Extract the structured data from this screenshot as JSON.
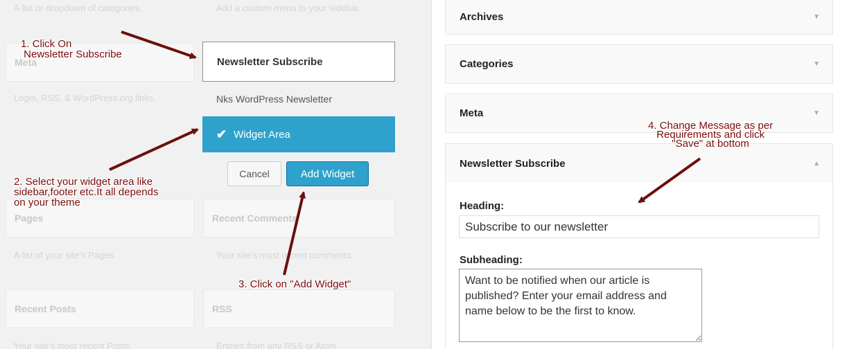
{
  "available_widgets": {
    "top_desc_left": "A list or dropdown of categories.",
    "top_desc_right": "Add a custom menu to your sidebar.",
    "meta_title": "Meta",
    "meta_desc": "Login, RSS, & WordPress.org links.",
    "pages_title": "Pages",
    "pages_desc": "A list of your site's Pages.",
    "recent_comments_title": "Recent Comments",
    "recent_comments_desc": "Your site's most recent comments.",
    "recent_posts_title": "Recent Posts",
    "recent_posts_desc": "Your site's most recent Posts.",
    "rss_title": "RSS",
    "rss_desc": "Entries from any RSS or Atom"
  },
  "chooser": {
    "selected_widget": "Newsletter Subscribe",
    "sidebar_name": "Nks WordPress Newsletter",
    "area_option": "Widget Area",
    "check_glyph": "✔",
    "cancel_label": "Cancel",
    "add_label": "Add Widget"
  },
  "sidebar_widgets": [
    {
      "title": "Archives",
      "arrow": "▼"
    },
    {
      "title": "Categories",
      "arrow": "▼"
    },
    {
      "title": "Meta",
      "arrow": "▼"
    },
    {
      "title": "Newsletter Subscribe",
      "arrow": "▲"
    }
  ],
  "newsletter_form": {
    "heading_label": "Heading:",
    "heading_value": "Subscribe to our newsletter",
    "subheading_label": "Subheading:",
    "subheading_value": "Want to be notified when our article is published? Enter your email address and name below to be the first to know."
  },
  "annotations": {
    "step1": "1. Click On\n Newsletter Subscribe",
    "step2": "2. Select your widget area like\nsidebar,footer etc.It all depends\non your theme",
    "step3": "3. Click on \"Add Widget\"",
    "step4": "4. Change Message as per\nRequirements and click\n\"Save\" at bottom"
  },
  "colors": {
    "accent": "#2ea2cc",
    "annotation": "#7a0a0a"
  }
}
